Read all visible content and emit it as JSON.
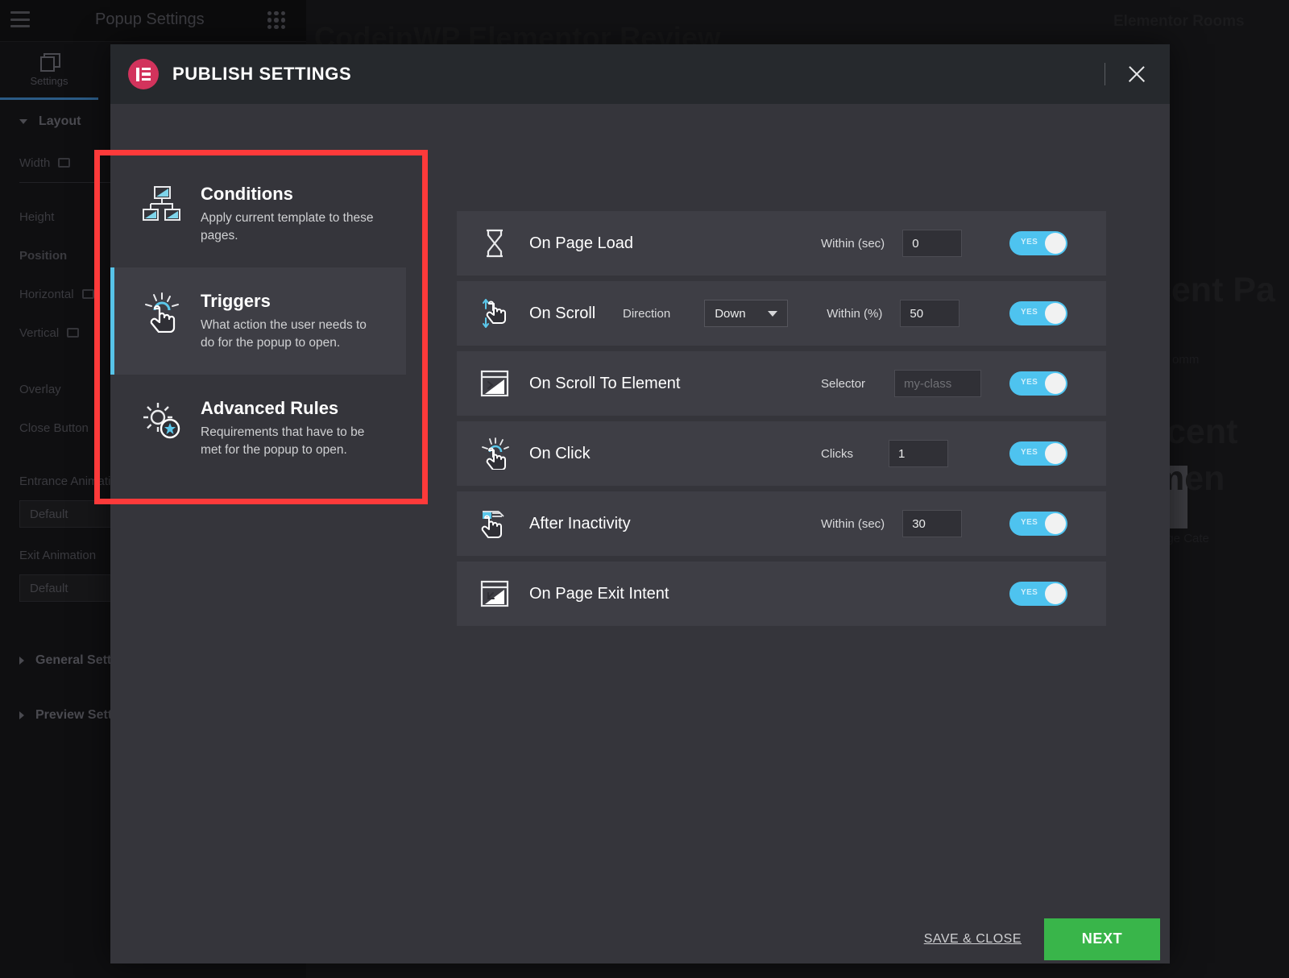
{
  "editor_panel": {
    "title": "Popup Settings",
    "menu_icon": "hamburger-icon",
    "grid_icon": "apps-grid-icon",
    "tab_settings": "Settings",
    "section_layout": "Layout",
    "fields": {
      "width": "Width",
      "height": "Height",
      "position": "Position",
      "horizontal": "Horizontal",
      "vertical": "Vertical",
      "overlay": "Overlay",
      "close_button": "Close Button",
      "entrance_animation": "Entrance Animation",
      "entrance_value": "Default",
      "exit_animation": "Exit Animation",
      "exit_value": "Default"
    },
    "section_general": "General Settings",
    "section_preview": "Preview Settings"
  },
  "background": {
    "page_title": "CodeinWP Elementor Review",
    "right_label": "Elementor Rooms",
    "big_1": "cent Pa",
    "big_2": "cent",
    "big_3": "men",
    "small_1": "omm",
    "small_2": "pge Cate"
  },
  "modal": {
    "logo_icon": "elementor-logo-icon",
    "title": "PUBLISH SETTINGS",
    "close_icon": "close-icon",
    "nav": [
      {
        "id": "conditions",
        "icon": "sitemap-icon",
        "title": "Conditions",
        "description": "Apply current template to these pages.",
        "active": false
      },
      {
        "id": "triggers",
        "icon": "click-hand-icon",
        "title": "Triggers",
        "description": "What action the user needs to do for the popup to open.",
        "active": true
      },
      {
        "id": "advanced-rules",
        "icon": "gear-star-icon",
        "title": "Advanced Rules",
        "description": "Requirements that have to be met for the popup to open.",
        "active": false
      }
    ],
    "triggers": [
      {
        "id": "on-page-load",
        "icon": "hourglass-icon",
        "label": "On Page Load",
        "control_label": "Within (sec)",
        "control_type": "number",
        "value": "0",
        "toggle": "YES",
        "toggle_on": true
      },
      {
        "id": "on-scroll",
        "icon": "scroll-hand-icon",
        "label": "On Scroll",
        "control_label": "Direction",
        "control_type": "select",
        "select_value": "Down",
        "control_label_2": "Within (%)",
        "value": "50",
        "toggle": "YES",
        "toggle_on": true
      },
      {
        "id": "on-scroll-to-element",
        "icon": "scroll-to-element-icon",
        "label": "On Scroll To Element",
        "control_label": "Selector",
        "control_type": "text",
        "value": "",
        "placeholder": "my-class",
        "toggle": "YES",
        "toggle_on": true
      },
      {
        "id": "on-click",
        "icon": "click-hand-icon",
        "label": "On Click",
        "control_label": "Clicks",
        "control_type": "number",
        "value": "1",
        "toggle": "YES",
        "toggle_on": true
      },
      {
        "id": "after-inactivity",
        "icon": "inactivity-hand-icon",
        "label": "After Inactivity",
        "control_label": "Within (sec)",
        "control_type": "number",
        "value": "30",
        "toggle": "YES",
        "toggle_on": true
      },
      {
        "id": "on-page-exit-intent",
        "icon": "exit-intent-icon",
        "label": "On Page Exit Intent",
        "control_label": "",
        "control_type": "none",
        "value": "",
        "toggle": "YES",
        "toggle_on": true
      }
    ],
    "footer": {
      "save_label": "SAVE & CLOSE",
      "next_label": "NEXT"
    }
  },
  "colors": {
    "accent_red": "#d2335c",
    "highlight_red": "#fd3a3a",
    "toggle_blue": "#4ec3ef",
    "active_blue": "#57c3e8",
    "next_green": "#39b54a",
    "modal_bg": "#35353b",
    "row_bg": "#3e3e45",
    "header_bg": "#26292d"
  }
}
